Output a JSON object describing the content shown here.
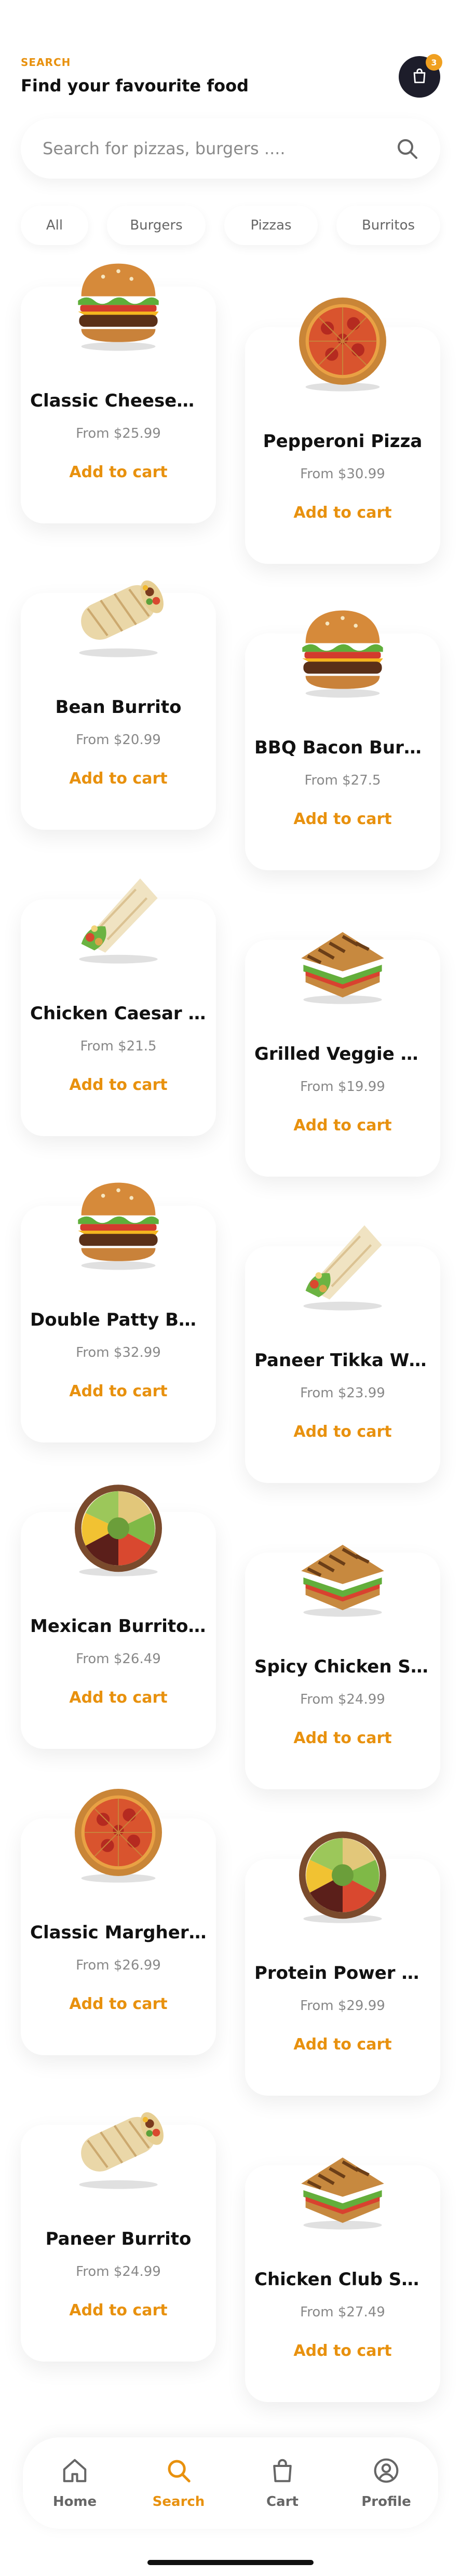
{
  "header": {
    "eyebrow": "SEARCH",
    "title": "Find your favourite food",
    "cart_count": "3"
  },
  "search": {
    "placeholder": "Search for pizzas, burgers ...."
  },
  "filters": [
    "All",
    "Burgers",
    "Pizzas",
    "Burritos"
  ],
  "products": [
    {
      "name": "Classic Cheeseburger",
      "price": "From $25.99",
      "cta": "Add to cart",
      "image": "burger"
    },
    {
      "name": "Pepperoni Pizza",
      "price": "From $30.99",
      "cta": "Add to cart",
      "image": "pizza"
    },
    {
      "name": "Bean Burrito",
      "price": "From $20.99",
      "cta": "Add to cart",
      "image": "burrito"
    },
    {
      "name": "BBQ Bacon Burger",
      "price": "From $27.5",
      "cta": "Add to cart",
      "image": "burger"
    },
    {
      "name": "Chicken Caesar Wrap",
      "price": "From $21.5",
      "cta": "Add to cart",
      "image": "wrap"
    },
    {
      "name": "Grilled Veggie Sandwich",
      "price": "From $19.99",
      "cta": "Add to cart",
      "image": "sandwich"
    },
    {
      "name": "Double Patty Burger",
      "price": "From $32.99",
      "cta": "Add to cart",
      "image": "burger"
    },
    {
      "name": "Paneer Tikka Wrap",
      "price": "From $23.99",
      "cta": "Add to cart",
      "image": "wrap"
    },
    {
      "name": "Mexican Burrito Bowl",
      "price": "From $26.49",
      "cta": "Add to cart",
      "image": "bowl"
    },
    {
      "name": "Spicy Chicken Sandwich",
      "price": "From $24.99",
      "cta": "Add to cart",
      "image": "sandwich"
    },
    {
      "name": "Classic Margherita",
      "price": "From $26.99",
      "cta": "Add to cart",
      "image": "pizza"
    },
    {
      "name": "Protein Power Bowl",
      "price": "From $29.99",
      "cta": "Add to cart",
      "image": "bowl"
    },
    {
      "name": "Paneer Burrito",
      "price": "From $24.99",
      "cta": "Add to cart",
      "image": "burrito"
    },
    {
      "name": "Chicken Club Sandwich",
      "price": "From $27.49",
      "cta": "Add to cart",
      "image": "sandwich"
    }
  ],
  "bottom_nav": [
    {
      "label": "Home",
      "icon": "home-icon"
    },
    {
      "label": "Search",
      "icon": "search-icon"
    },
    {
      "label": "Cart",
      "icon": "bag-icon"
    },
    {
      "label": "Profile",
      "icon": "profile-icon"
    }
  ],
  "colors": {
    "accent": "#e8910e",
    "dark": "#1d1d2a",
    "muted": "#888888"
  }
}
